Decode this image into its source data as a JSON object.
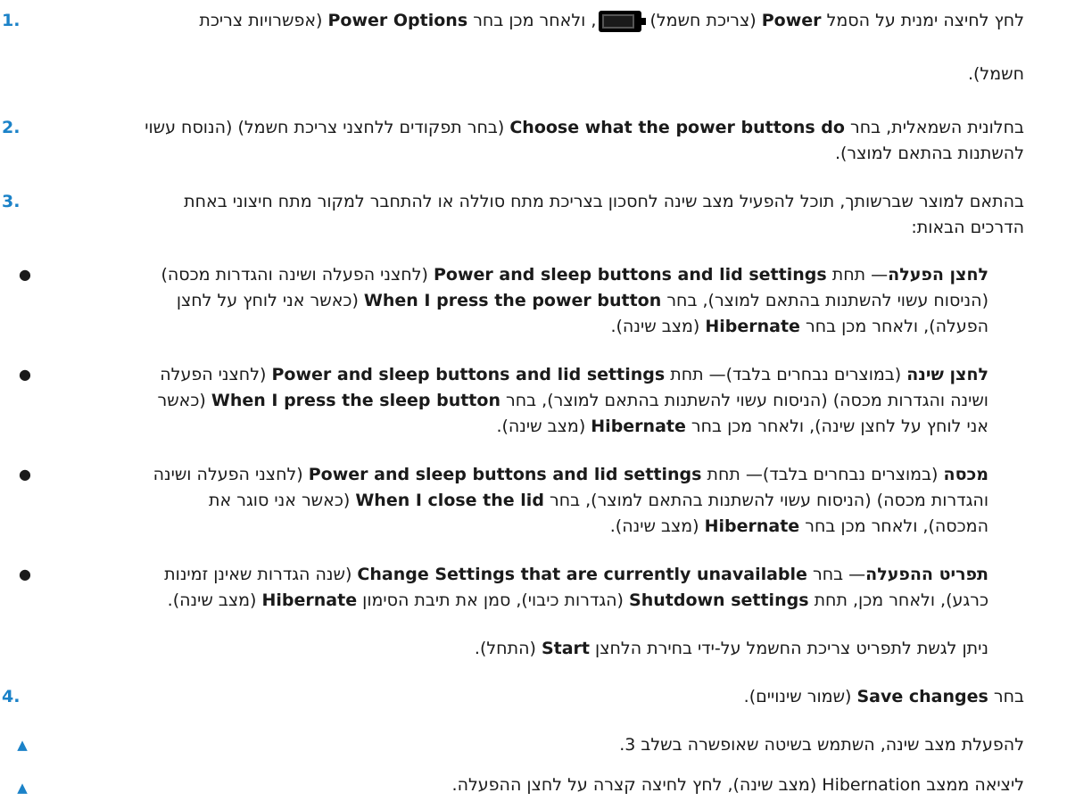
{
  "steps": [
    {
      "number": "1.",
      "p1": "לחץ לחיצה ימנית על הסמל",
      "b1": "Power",
      "p2": "(צריכת חשמל)",
      "p3": ", ולאחר מכן בחר",
      "b2": "Power Options",
      "p4": "(אפשרויות צריכת",
      "p5": "חשמל)."
    },
    {
      "number": "2.",
      "p1": "בחלונית השמאלית, בחר",
      "b1": "Choose what the power buttons do",
      "p2": "(בחר תפקודים ללחצני צריכת חשמל) (הנוסח עשוי",
      "p3": "להשתנות בהתאם למוצר)."
    },
    {
      "number": "3.",
      "line1": "בהתאם למוצר שברשותך, תוכל להפעיל מצב שינה לחסכון בצריכת מתח סוללה או להתחבר למקור מתח חיצוני באחת",
      "line2": "הדרכים הבאות:"
    },
    {
      "number": "4.",
      "p1": "בחר",
      "b1": "Save changes",
      "p2": "(שמור שינויים)."
    }
  ],
  "bullets": [
    {
      "lead": "לחצן הפעלה",
      "l1a": "— תחת",
      "l1b": "Power and sleep buttons and lid settings",
      "l1c": "(לחצני הפעלה ושינה והגדרות מכסה)",
      "l2a": "(הניסוח עשוי להשתנות בהתאם למוצר), בחר",
      "l2b": "When I press the power button",
      "l2c": "(כאשר אני לוחץ על לחצן",
      "l3a": "הפעלה), ולאחר מכן בחר",
      "l3b": "Hibernate",
      "l3c": "(מצב שינה)."
    },
    {
      "lead": "לחצן שינה",
      "l1a": "(במוצרים נבחרים בלבד)— תחת",
      "l1b": "Power and sleep buttons and lid settings",
      "l1c": "(לחצני הפעלה",
      "l2a": "ושינה והגדרות מכסה) (הניסוח עשוי להשתנות בהתאם למוצר), בחר",
      "l2b": "When I press the sleep button",
      "l2c": "(כאשר",
      "l3a": "אני לוחץ על לחצן שינה), ולאחר מכן בחר",
      "l3b": "Hibernate",
      "l3c": "(מצב שינה)."
    },
    {
      "lead": "מכסה",
      "l1a": "(במוצרים נבחרים בלבד)— תחת",
      "l1b": "Power and sleep buttons and lid settings",
      "l1c": "(לחצני הפעלה ושינה",
      "l2a": "והגדרות מכסה) (הניסוח עשוי להשתנות בהתאם למוצר), בחר",
      "l2b": "When I close the lid",
      "l2c": "(כאשר אני סוגר את",
      "l3a": "המכסה), ולאחר מכן בחר",
      "l3b": "Hibernate",
      "l3c": "(מצב שינה)."
    },
    {
      "lead": "תפריט ההפעלה",
      "l1a": "— בחר",
      "l1b": "Change Settings that are currently unavailable",
      "l1c": "(שנה הגדרות שאינן זמינות",
      "l2a": "כרגע), ולאחר מכן, תחת",
      "l2b": "Shutdown settings",
      "l2c": "(הגדרות כיבוי), סמן את תיבת הסימון",
      "l2d": "Hibernate",
      "l2e": "(מצב שינה)."
    }
  ],
  "note": {
    "a": "ניתן לגשת לתפריט צריכת החשמל על-ידי בחירת הלחצן",
    "b": "Start",
    "c": "(התחל)."
  },
  "tips": [
    "להפעלת מצב שינה, השתמש בשיטה שאופשרה בשלב 3.",
    "ליציאה ממצב Hibernation (מצב שינה), לחץ לחיצה קצרה על לחצן ההפעלה."
  ],
  "icons": {
    "battery": "battery-icon",
    "bullet": "bullet-dot-icon",
    "tip": "triangle-icon"
  },
  "colors": {
    "accent": "#1b82c8",
    "text": "#1a1a1a"
  }
}
